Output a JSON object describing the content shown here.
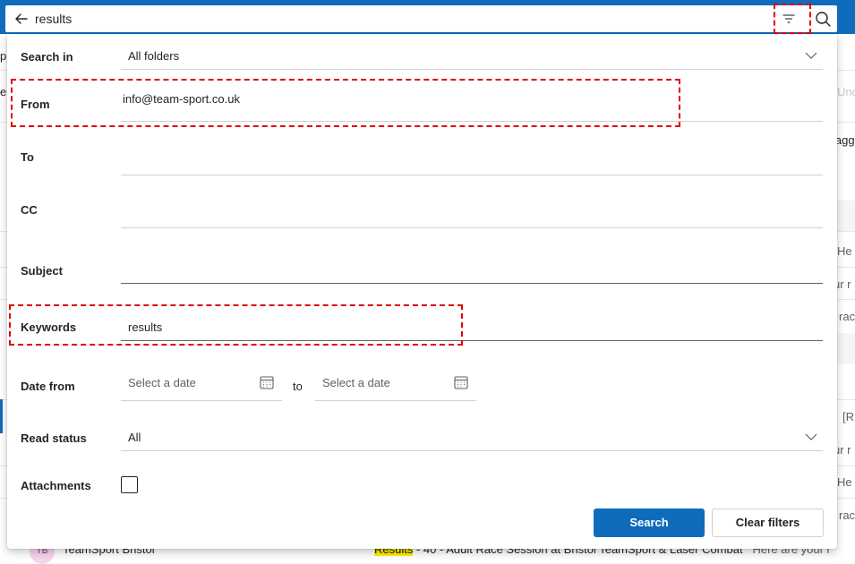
{
  "search": {
    "query": "results"
  },
  "icons": {
    "back": "arrow-left-icon",
    "filter": "filter-icon",
    "search": "search-icon",
    "calendar": "calendar-icon",
    "chevron": "chevron-down-icon"
  },
  "colors": {
    "accent": "#0f6cbd",
    "highlight": "#fff100",
    "annotation": "#e00000"
  },
  "filter_panel": {
    "search_in": {
      "label": "Search in",
      "value": "All folders"
    },
    "from": {
      "label": "From",
      "value": "info@team-sport.co.uk"
    },
    "to": {
      "label": "To",
      "value": ""
    },
    "cc": {
      "label": "CC",
      "value": ""
    },
    "subject": {
      "label": "Subject",
      "value": ""
    },
    "keywords": {
      "label": "Keywords",
      "value": "results"
    },
    "date": {
      "label": "Date from",
      "from_placeholder": "Select a date",
      "to_label": "to",
      "to_placeholder": "Select a date"
    },
    "read_status": {
      "label": "Read status",
      "value": "All"
    },
    "attachments": {
      "label": "Attachments",
      "checked": false
    },
    "search_button": "Search",
    "clear_button": "Clear filters"
  },
  "background": {
    "left_fragments": [
      "p",
      "e"
    ],
    "toolbar_right": [
      "Und",
      "lagg"
    ],
    "snippets": [
      "He",
      "ur r",
      "rac",
      "[R",
      "ur r",
      "He",
      "rac"
    ],
    "bottom_row": {
      "avatar": "TB",
      "sender": "TeamSport Bristol",
      "subject_highlight": "Results",
      "subject_rest": " - 40 - Adult Race Session at Bristol TeamSport & Laser Combat",
      "preview": "Here are your r"
    }
  }
}
